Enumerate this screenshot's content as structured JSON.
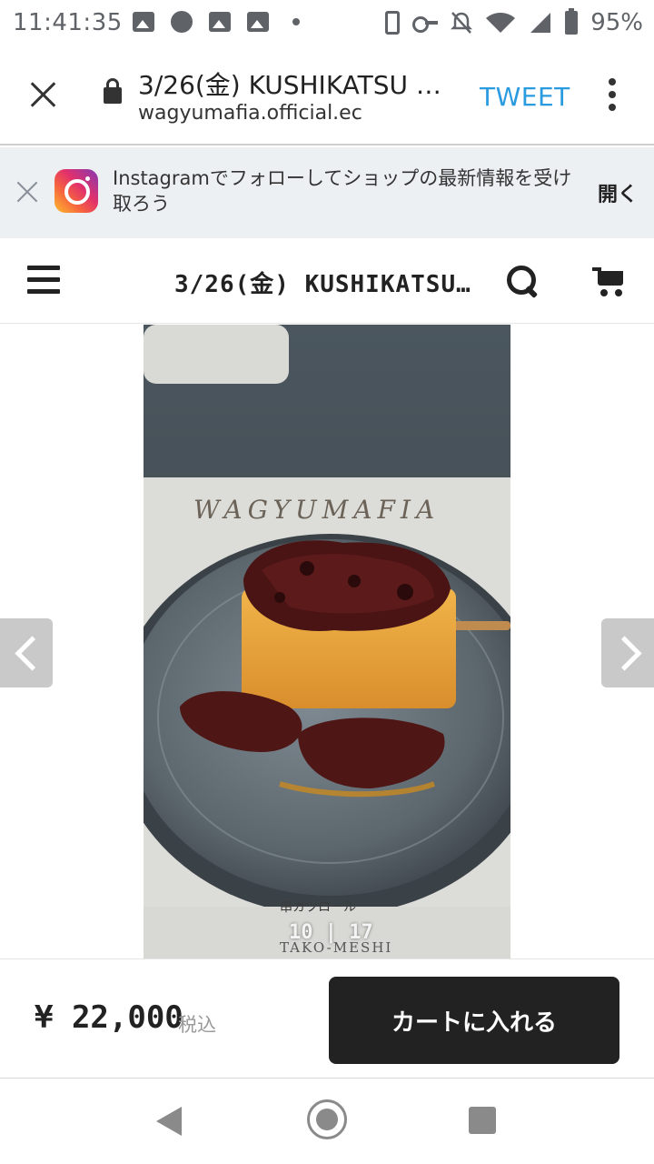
{
  "status_bar": {
    "time": "11:41:35",
    "battery_percent": "95%",
    "icons": [
      "image-icon",
      "message-icon",
      "image-icon",
      "image-icon",
      "dot-icon",
      "phone-icon",
      "key-icon",
      "bell-off-icon",
      "wifi-icon",
      "signal-icon",
      "battery-icon"
    ]
  },
  "browser": {
    "title": "3/26(金) KUSHIKATSU …",
    "domain": "wagyumafia.official.ec",
    "action_label": "TWEET",
    "action_color": "#2b9be0"
  },
  "banner": {
    "text": "Instagramでフォローしてショップの最新情報を受け取ろう",
    "open_label": "開く"
  },
  "shop": {
    "title": "3/26(金) KUSHIKATSU…"
  },
  "gallery": {
    "counter": "10 | 17",
    "photo_printed_text": [
      "WAGYUMAFIA",
      "串カツロール",
      "TAKO-MESHI"
    ]
  },
  "purchase": {
    "price": "¥ 22,000",
    "tax_label": "税込",
    "add_to_cart_label": "カートに入れる",
    "button_color": "#222222"
  }
}
